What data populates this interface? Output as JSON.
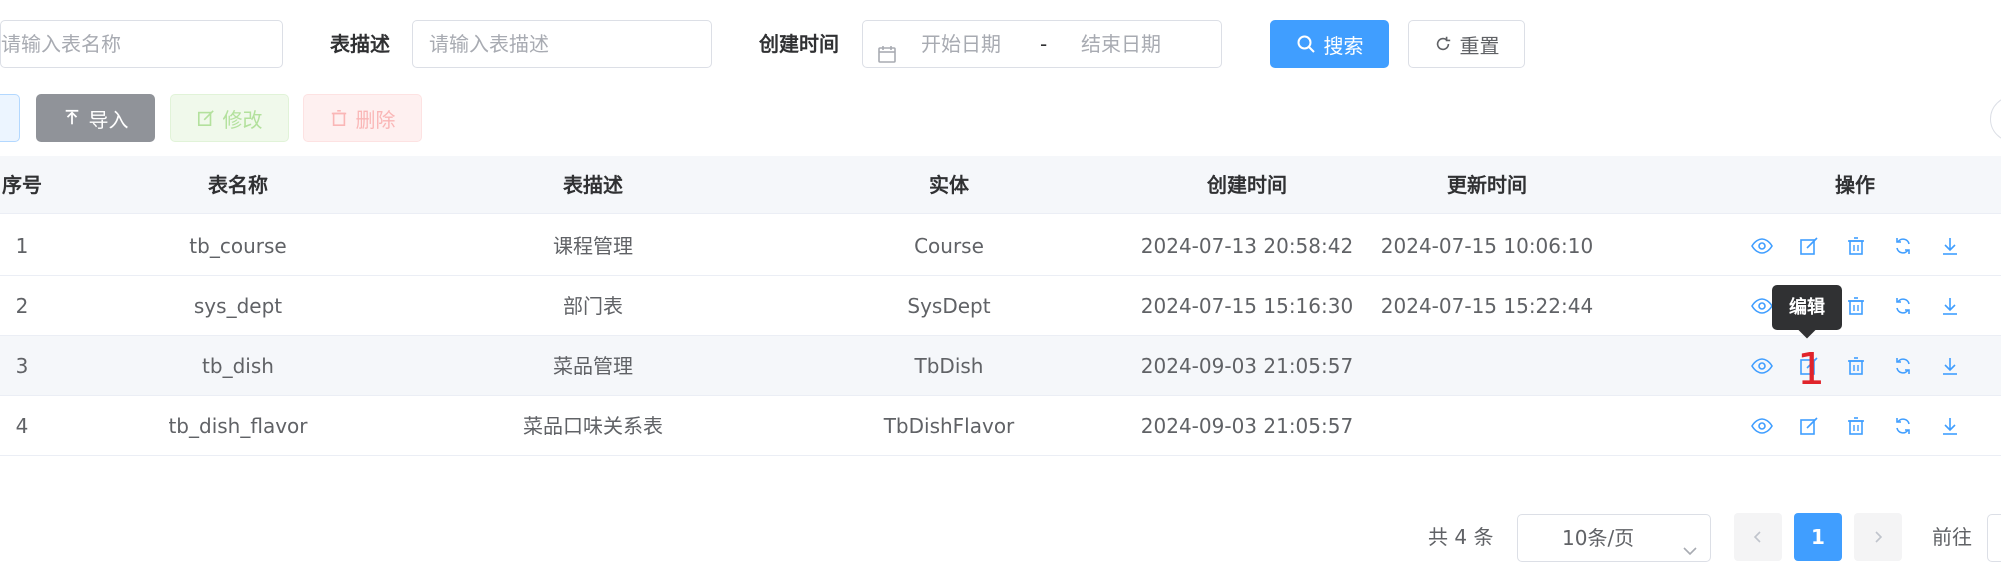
{
  "search": {
    "table_name_placeholder": "请输入表名称",
    "table_desc_label": "表描述",
    "table_desc_placeholder": "请输入表描述",
    "create_time_label": "创建时间",
    "start_date_placeholder": "开始日期",
    "date_separator": "-",
    "end_date_placeholder": "结束日期",
    "search_button": "搜索",
    "reset_button": "重置"
  },
  "toolbar": {
    "import_button": "导入",
    "edit_button": "修改",
    "delete_button": "删除"
  },
  "table": {
    "headers": {
      "index": "序号",
      "name": "表名称",
      "desc": "表描述",
      "entity": "实体",
      "created": "创建时间",
      "updated": "更新时间",
      "ops": "操作"
    },
    "rows": [
      {
        "index": "1",
        "name": "tb_course",
        "desc": "课程管理",
        "entity": "Course",
        "created": "2024-07-13 20:58:42",
        "updated": "2024-07-15 10:06:10"
      },
      {
        "index": "2",
        "name": "sys_dept",
        "desc": "部门表",
        "entity": "SysDept",
        "created": "2024-07-15 15:16:30",
        "updated": "2024-07-15 15:22:44"
      },
      {
        "index": "3",
        "name": "tb_dish",
        "desc": "菜品管理",
        "entity": "TbDish",
        "created": "2024-09-03 21:05:57",
        "updated": ""
      },
      {
        "index": "4",
        "name": "tb_dish_flavor",
        "desc": "菜品口味关系表",
        "entity": "TbDishFlavor",
        "created": "2024-09-03 21:05:57",
        "updated": ""
      }
    ]
  },
  "tooltip": {
    "text": "编辑"
  },
  "annotation": {
    "text": "1"
  },
  "pagination": {
    "total": "共 4 条",
    "page_size": "10条/页",
    "current_page": "1",
    "goto_label": "前往"
  },
  "colors": {
    "primary": "#409eff",
    "info": "#909399",
    "annotation": "#e0242b"
  }
}
